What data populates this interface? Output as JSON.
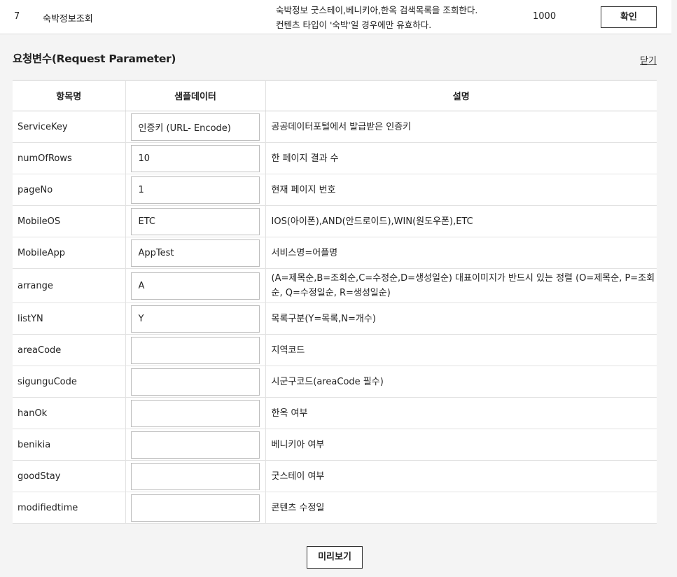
{
  "top_row": {
    "number": "7",
    "name": "숙박정보조회",
    "description_line1": "숙박정보 굿스테이,베니키아,한옥 검색목록을 조회한다.",
    "description_line2": "컨텐츠 타입이 '숙박'일 경우에만 유효하다.",
    "count": "1000",
    "confirm_label": "확인"
  },
  "section": {
    "title": "요청변수(Request Parameter)",
    "close_label": "닫기"
  },
  "table": {
    "headers": [
      "항목명",
      "샘플데이터",
      "설명"
    ],
    "rows": [
      {
        "key": "ServiceKey",
        "sample": "인증키 (URL- Encode)",
        "desc": "공공데이터포털에서 발급받은 인증키"
      },
      {
        "key": "numOfRows",
        "sample": "10",
        "desc": "한 페이지 결과 수"
      },
      {
        "key": "pageNo",
        "sample": "1",
        "desc": "현재 페이지 번호"
      },
      {
        "key": "MobileOS",
        "sample": "ETC",
        "desc": "IOS(아이폰),AND(안드로이드),WIN(원도우폰),ETC"
      },
      {
        "key": "MobileApp",
        "sample": "AppTest",
        "desc": "서비스명=어플명"
      },
      {
        "key": "arrange",
        "sample": "A",
        "desc": "(A=제목순,B=조회순,C=수정순,D=생성일순) 대표이미지가 반드시 있는 정렬 (O=제목순, P=조회순, Q=수정일순, R=생성일순)"
      },
      {
        "key": "listYN",
        "sample": "Y",
        "desc": "목록구분(Y=목록,N=개수)"
      },
      {
        "key": "areaCode",
        "sample": "",
        "desc": "지역코드"
      },
      {
        "key": "sigunguCode",
        "sample": "",
        "desc": "시군구코드(areaCode 필수)"
      },
      {
        "key": "hanOk",
        "sample": "",
        "desc": "한옥 여부"
      },
      {
        "key": "benikia",
        "sample": "",
        "desc": "베니키아 여부"
      },
      {
        "key": "goodStay",
        "sample": "",
        "desc": "굿스테이 여부"
      },
      {
        "key": "modifiedtime",
        "sample": "",
        "desc": "콘텐츠 수정일"
      }
    ]
  },
  "preview_label": "미리보기"
}
